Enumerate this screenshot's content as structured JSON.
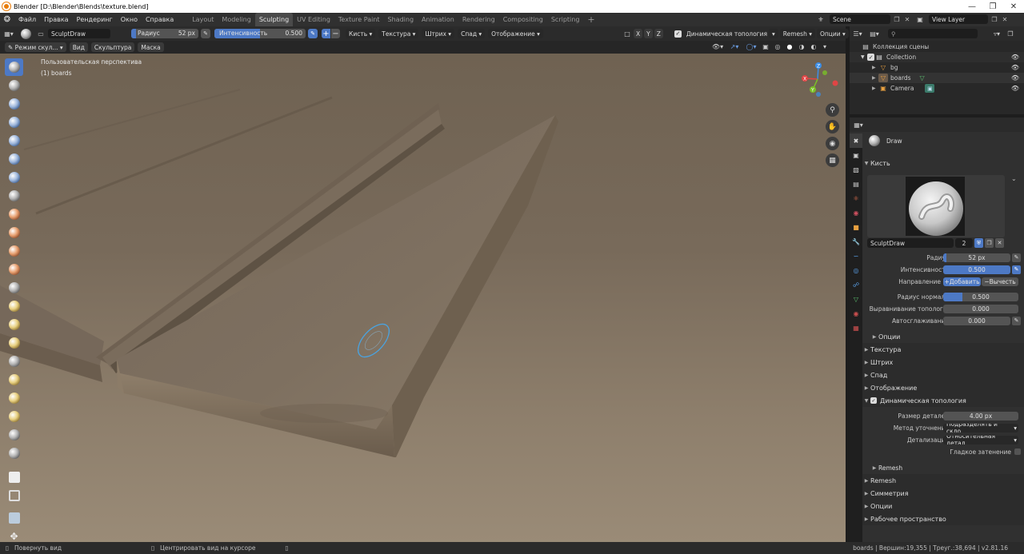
{
  "window": {
    "title": "Blender [D:\\Blender\\Blends\\texture.blend]"
  },
  "menu": {
    "items": [
      "Файл",
      "Правка",
      "Рендеринг",
      "Окно",
      "Справка"
    ]
  },
  "workspaces": [
    "Layout",
    "Modeling",
    "Sculpting",
    "UV Editing",
    "Texture Paint",
    "Shading",
    "Animation",
    "Rendering",
    "Compositing",
    "Scripting"
  ],
  "active_workspace": "Sculpting",
  "scene": {
    "name": "Scene",
    "view_layer": "View Layer"
  },
  "tool_header": {
    "brush_name": "SculptDraw",
    "radius_label": "Радиус",
    "radius_value": "52 px",
    "strength_label": "Интенсивность",
    "strength_value": "0.500",
    "menus": [
      "Кисть",
      "Текстура",
      "Штрих",
      "Спад",
      "Отображение"
    ],
    "symmetry": [
      "X",
      "Y",
      "Z"
    ],
    "dyntopo_label": "Динамическая топология",
    "remesh": "Remesh",
    "options": "Опции"
  },
  "view_header": {
    "mode": "Режим скул...",
    "menus": [
      "Вид",
      "Скульптура",
      "Маска"
    ]
  },
  "viewport": {
    "overlay_line1": "Пользовательская перспектива",
    "overlay_line2": "(1) boards",
    "gizmo": {
      "x": "X",
      "y": "Y",
      "z": "Z"
    },
    "colors": {
      "x": "#e04545",
      "y": "#7bbf28",
      "z": "#3b8ee8"
    }
  },
  "outliner": {
    "root": "Коллекция сцены",
    "items": [
      {
        "name": "Collection",
        "level": 1
      },
      {
        "name": "bg",
        "level": 2
      },
      {
        "name": "boards",
        "level": 2
      },
      {
        "name": "Camera",
        "level": 2
      }
    ]
  },
  "properties": {
    "tool_title": "Draw",
    "brush_section": "Кисть",
    "brush_name": "SculptDraw",
    "users": "2",
    "fields": [
      {
        "label": "Радиус",
        "value": "52 px"
      },
      {
        "label": "Интенсивность",
        "value": "0.500"
      },
      {
        "label": "Радиус нормали",
        "value": "0.500"
      },
      {
        "label": "Выравнивание тополог...",
        "value": "0.000"
      },
      {
        "label": "Автосглаживание",
        "value": "0.000"
      }
    ],
    "direction_label": "Направление",
    "direction_add": "Добавить",
    "direction_sub": "Вычесть",
    "options_sub": "Опции",
    "sections": [
      "Текстура",
      "Штрих",
      "Спад",
      "Отображение"
    ],
    "dyntopo_section": "Динамическая топология",
    "detail_size_label": "Размер деталей",
    "detail_size_value": "4.00 px",
    "refine_label": "Метод уточнения",
    "refine_value": "Подразделять и скло...",
    "detailing_label": "Детализация",
    "detailing_value": "Относительная детал...",
    "smooth_shading_label": "Гладкое затенение",
    "remesh_sub": "Remesh",
    "bottom_sections": [
      "Remesh",
      "Симметрия",
      "Опции",
      "Рабочее пространство"
    ]
  },
  "status": {
    "left1": "Повернуть вид",
    "left2": "Центрировать вид на курсоре",
    "right": "boards | Вершин:19,355 | Треуг.:38,694 | v2.81.16"
  },
  "accent": "#4d79c5"
}
